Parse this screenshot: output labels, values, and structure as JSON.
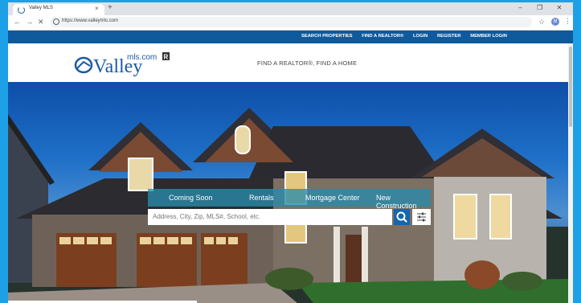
{
  "browser": {
    "tab_title": "Valley MLS",
    "tab_close": "×",
    "new_tab": "+",
    "url": "https://www.valleymls.com",
    "window_buttons": [
      "–",
      "❐",
      "✕"
    ],
    "nav": {
      "back": "←",
      "forward": "→",
      "reload": "✕"
    },
    "star": "☆",
    "avatar_letter": "M",
    "menu": "⋮"
  },
  "site_nav": {
    "links": [
      "SEARCH PROPERTIES",
      "FIND A REALTOR®",
      "LOGIN",
      "REGISTER",
      "MEMBER LOGIN"
    ]
  },
  "header": {
    "logo_text": "Valley",
    "logo_suffix": "mls.com",
    "realtor_mark": "R",
    "tagline": "FIND A REALTOR®, FIND A HOME"
  },
  "search": {
    "tabs": [
      "Coming Soon",
      "Rentals",
      "Mortgage Center",
      "New Construction"
    ],
    "placeholder": "Address, City, Zip, MLS#, School, etc."
  },
  "colors": {
    "brand_blue": "#0f5a9c",
    "page_bg": "#1ea0e6",
    "search_button": "#1565b0"
  },
  "icons": {
    "search": "search-icon",
    "filters": "sliders-icon"
  }
}
